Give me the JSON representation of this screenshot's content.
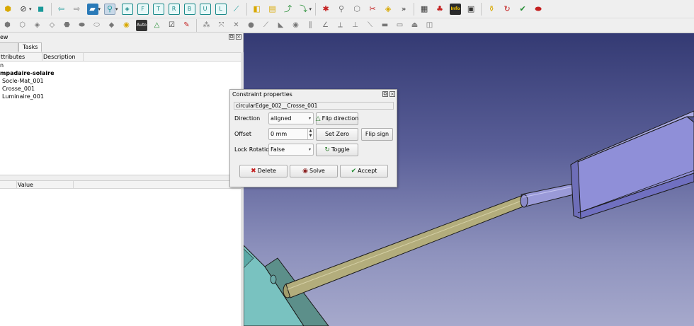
{
  "left_panel": {
    "title": "ew",
    "tabs": [
      "",
      "Tasks"
    ],
    "tree_columns": [
      "ttributes",
      "Description"
    ],
    "tree_rows": [
      "n",
      "mpadaire-solaire",
      "Socle-Mat_001",
      "Crosse_001",
      "Luminaire_001"
    ],
    "props_columns": [
      "",
      "Value"
    ]
  },
  "dialog": {
    "title": "Constraint properties",
    "constraint_name": "circularEdge_002__Crosse_001",
    "direction_label": "Direction",
    "direction_value": "aligned",
    "flip_direction_label": "Flip direction",
    "offset_label": "Offset",
    "offset_value": "0 mm",
    "set_zero_label": "Set Zero",
    "flip_sign_label": "Flip sign",
    "lock_rotation_label": "Lock Rotation",
    "lock_rotation_value": "False",
    "toggle_label": "Toggle",
    "delete_label": "Delete",
    "solve_label": "Solve",
    "accept_label": "Accept"
  },
  "toolbar": {
    "auto_label": "Auto",
    "info_label": "Info",
    "overflow": "»"
  },
  "colors": {
    "viewport_top": "#343a73",
    "viewport_bottom": "#a6a9cc",
    "rod": "#b3ad7c",
    "arm": "#9a9ad8",
    "lamp_box": "#8f8fd8",
    "mast": "#79c2c0",
    "delete_icon": "#c42020",
    "accept_icon": "#1f8b2f"
  }
}
